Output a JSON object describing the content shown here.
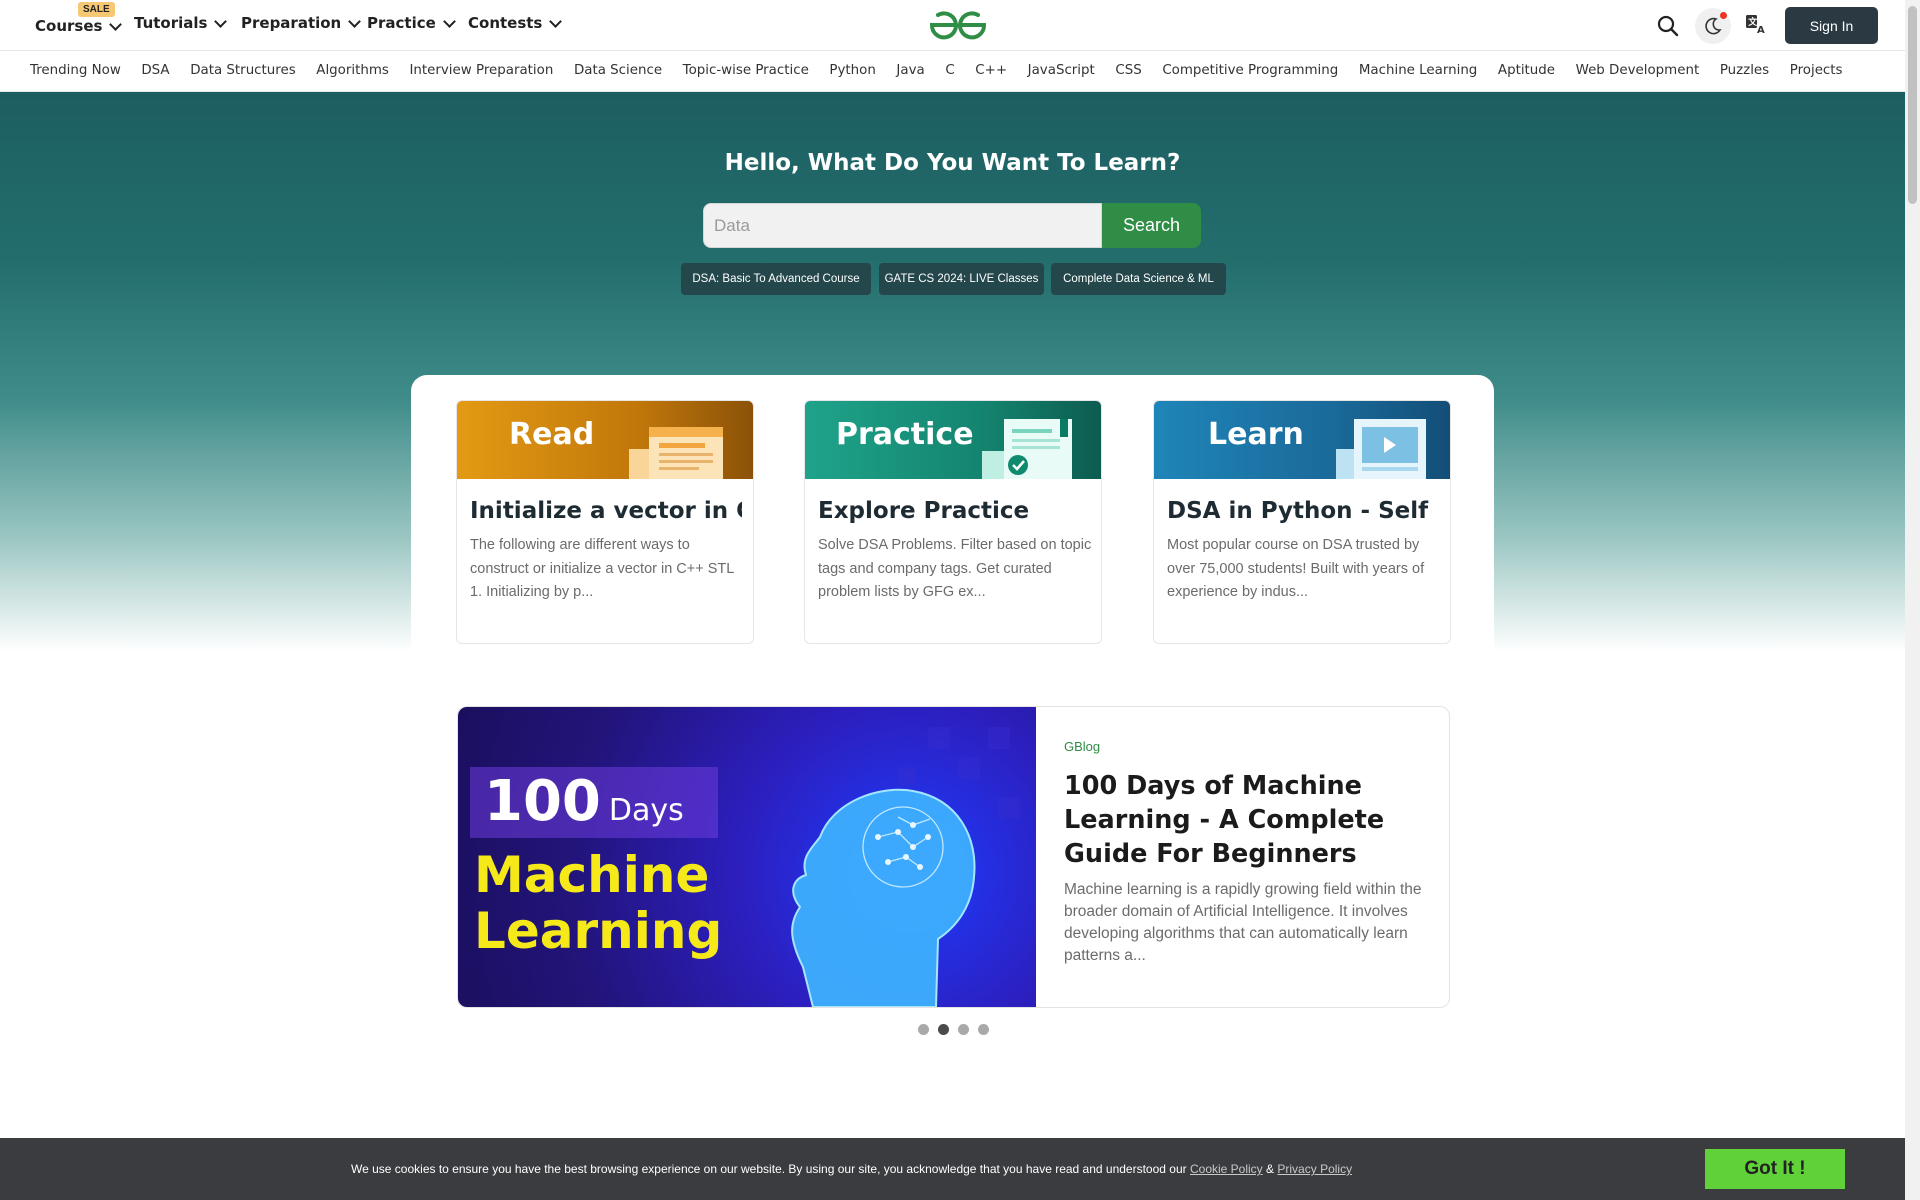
{
  "topnav": {
    "items": [
      "Courses",
      "Tutorials",
      "Preparation",
      "Practice",
      "Contests"
    ],
    "sale_badge": "SALE",
    "signin_label": "Sign In"
  },
  "subnav": {
    "items": [
      "Trending Now",
      "DSA",
      "Data Structures",
      "Algorithms",
      "Interview Preparation",
      "Data Science",
      "Topic-wise Practice",
      "Python",
      "Java",
      "C",
      "C++",
      "JavaScript",
      "CSS",
      "Competitive Programming",
      "Machine Learning",
      "Aptitude",
      "Web Development",
      "Puzzles",
      "Projects"
    ]
  },
  "hero": {
    "title": "Hello, What Do You Want To Learn?",
    "search_placeholder": "Data",
    "search_button": "Search",
    "chips": [
      "DSA: Basic To Advanced Course",
      "GATE CS 2024: LIVE Classes",
      "Complete Data Science & ML"
    ]
  },
  "cards": [
    {
      "banner": "Read",
      "title": "Initialize a vector in C++",
      "desc": "The following are different ways to construct or initialize a vector in C++ STL 1. Initializing by p..."
    },
    {
      "banner": "Practice",
      "title": "Explore Practice",
      "desc": "Solve DSA Problems. Filter based on topic tags and company tags. Get curated problem lists by GFG ex..."
    },
    {
      "banner": "Learn",
      "title": "DSA in Python - Self",
      "desc": "Most popular course on DSA trusted by over 75,000 students! Built with years of experience by indus..."
    }
  ],
  "feature": {
    "image_days_number": "100",
    "image_days_word": "Days",
    "image_line1": "Machine",
    "image_line2": "Learning",
    "category": "GBlog",
    "title": "100 Days of Machine Learning - A Complete Guide For Beginners",
    "desc": "Machine learning is a rapidly growing field within the broader domain of Artificial Intelligence. It involves developing algorithms that can automatically learn patterns a..."
  },
  "carousel": {
    "active_index": 1,
    "count": 4
  },
  "cookie": {
    "text": "We use cookies to ensure you have the best browsing experience on our website. By using our site, you acknowledge that you have read and understood our",
    "cookie_link": "Cookie Policy",
    "amp": "&",
    "privacy_link": "Privacy Policy",
    "button": "Got It !"
  },
  "colors": {
    "brand_green": "#2f8d46",
    "hero_teal": "#1d5e61",
    "cookie_bg": "#3b3c40",
    "got_it_green": "#61d13a"
  }
}
